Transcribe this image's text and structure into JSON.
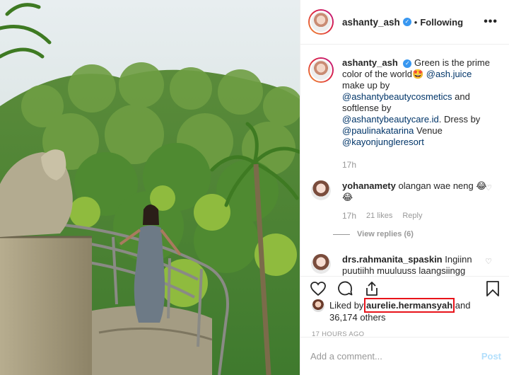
{
  "header": {
    "username": "ashanty_ash",
    "dot": "•",
    "follow_status": "Following",
    "more": "•••"
  },
  "caption": {
    "username": "ashanty_ash",
    "text_1": " Green is the prime color of the world🤩 ",
    "tag_1": "@ash.juice",
    "text_2": " make up by ",
    "tag_2": "@ashantybeautycosmetics",
    "text_3": " and softlense by ",
    "tag_3": "@ashantybeautycare.id",
    "text_4": ". Dress by ",
    "tag_4": "@paulinakatarina",
    "text_5": " Venue ",
    "tag_5": "@kayonjungleresort",
    "time": "17h"
  },
  "comments": [
    {
      "username": "yohanamety",
      "text": " olangan wae neng 😂😂",
      "time": "17h",
      "likes": "21 likes",
      "reply": "Reply",
      "view_replies": "View replies (6)"
    },
    {
      "username": "drs.rahmanita_spaskin",
      "text": " Ingiinn puutiihh muuluuss laangsiingg ideeaall seepeertii kaakaaa artiss…"
    }
  ],
  "likes": {
    "prefix": "Liked by ",
    "user": "aurelie.hermansyah",
    "suffix": " and 36,174 others"
  },
  "timestamp": "17 HOURS AGO",
  "comment_box": {
    "placeholder": "Add a comment...",
    "post_label": "Post"
  },
  "colors": {
    "highlight": "#e8131a",
    "link": "#003569",
    "verified": "#3897f0",
    "post_disabled": "#b2dffc"
  },
  "icons": [
    "verified-badge-icon",
    "more-options-icon",
    "heart-icon",
    "comment-icon",
    "share-icon",
    "bookmark-icon"
  ]
}
